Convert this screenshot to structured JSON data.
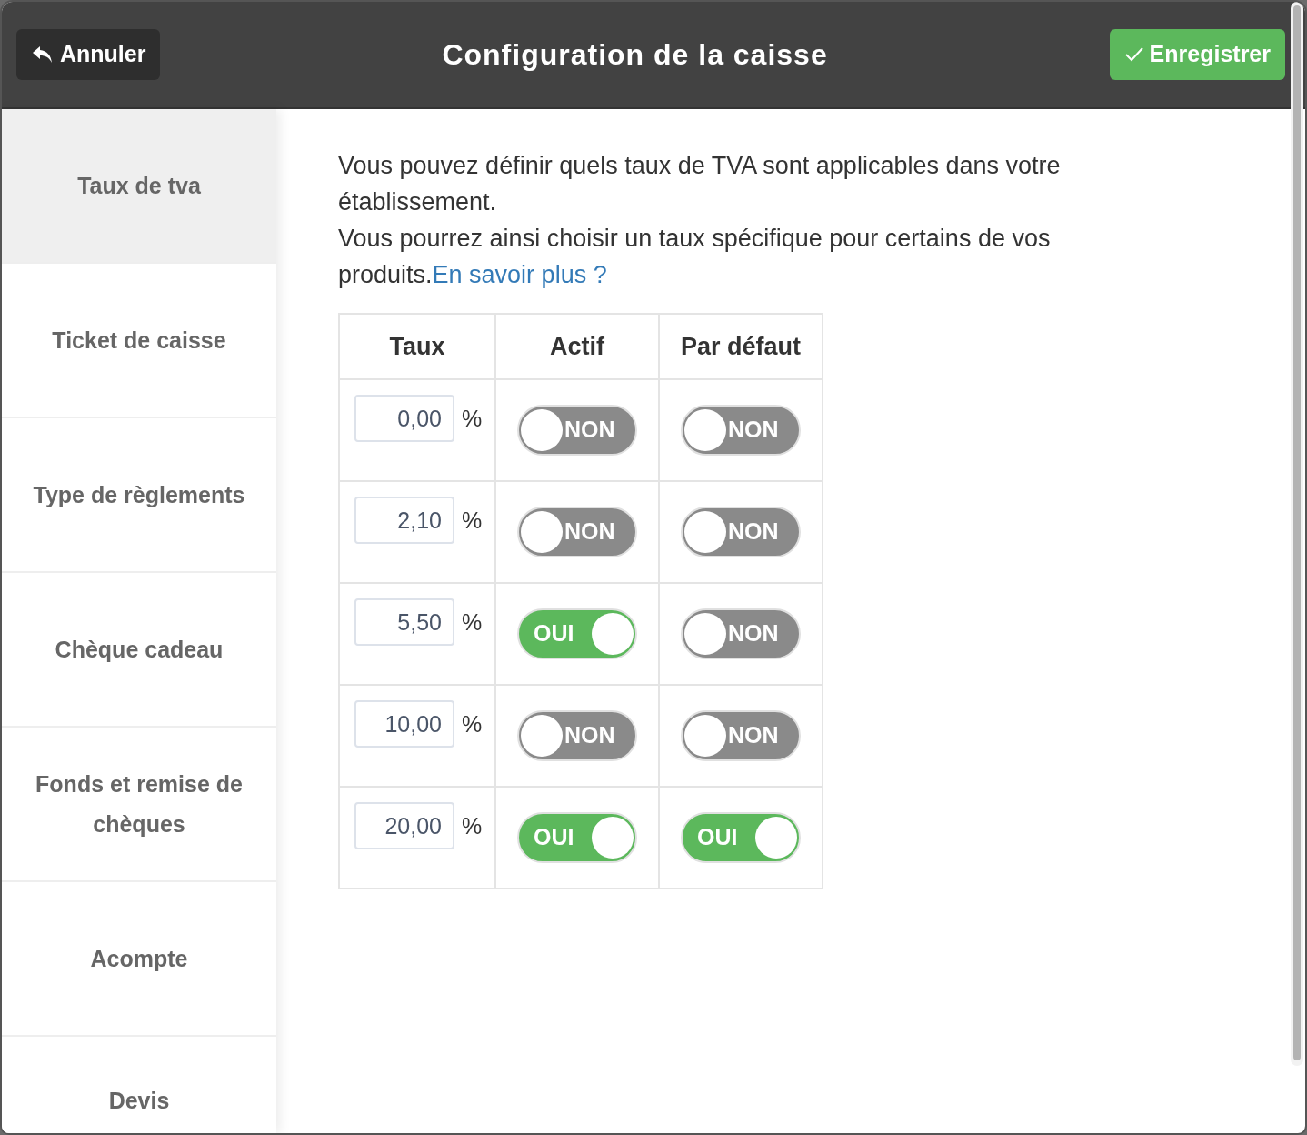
{
  "header": {
    "cancel": "Annuler",
    "title": "Configuration de la caisse",
    "save": "Enregistrer"
  },
  "sidebar": {
    "items": [
      {
        "label": "Taux de tva",
        "selected": true
      },
      {
        "label": "Ticket de caisse",
        "selected": false
      },
      {
        "label": "Type de règlements",
        "selected": false
      },
      {
        "label": "Chèque cadeau",
        "selected": false
      },
      {
        "label": "Fonds et remise de chèques",
        "selected": false
      },
      {
        "label": "Acompte",
        "selected": false
      },
      {
        "label": "Devis",
        "selected": false
      }
    ]
  },
  "intro": [
    "Vous pouvez définir quels taux de TVA sont applicables dans votre établissement.",
    "Vous pourrez ainsi choisir un taux spécifique pour certains de vos produits."
  ],
  "link": "En savoir plus ?",
  "table": {
    "columns": [
      "Taux",
      "Actif",
      "Par défaut"
    ],
    "rows": [
      {
        "rate": "0,00",
        "unit": "%",
        "active": {
          "on": false,
          "label": "NON"
        },
        "default": {
          "on": false,
          "label": "NON"
        }
      },
      {
        "rate": "2,10",
        "unit": "%",
        "active": {
          "on": false,
          "label": "NON"
        },
        "default": {
          "on": false,
          "label": "NON"
        }
      },
      {
        "rate": "5,50",
        "unit": "%",
        "active": {
          "on": true,
          "label": "OUI"
        },
        "default": {
          "on": false,
          "label": "NON"
        }
      },
      {
        "rate": "10,00",
        "unit": "%",
        "active": {
          "on": false,
          "label": "NON"
        },
        "default": {
          "on": false,
          "label": "NON"
        }
      },
      {
        "rate": "20,00",
        "unit": "%",
        "active": {
          "on": true,
          "label": "OUI"
        },
        "default": {
          "on": true,
          "label": "OUI"
        }
      }
    ]
  }
}
